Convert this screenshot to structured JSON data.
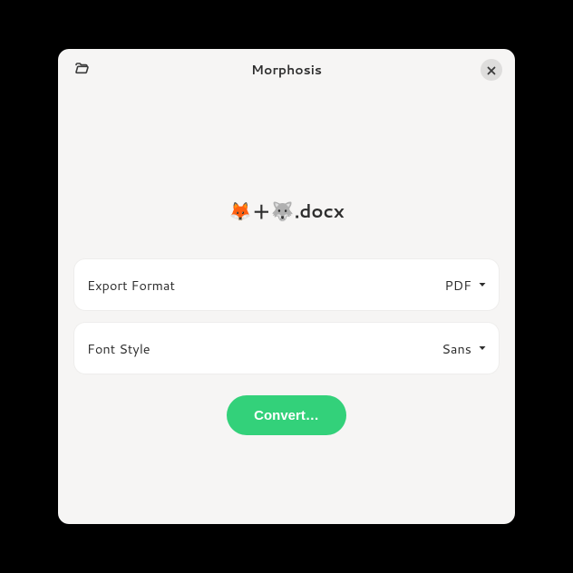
{
  "header": {
    "title": "Morphosis"
  },
  "file": {
    "emoji1": "🦊",
    "plus": "＋",
    "emoji2": "🐺",
    "ext": ".docx"
  },
  "options": {
    "export": {
      "label": "Export Format",
      "value": "PDF"
    },
    "font": {
      "label": "Font Style",
      "value": "Sans"
    }
  },
  "actions": {
    "convert": "Convert…"
  }
}
